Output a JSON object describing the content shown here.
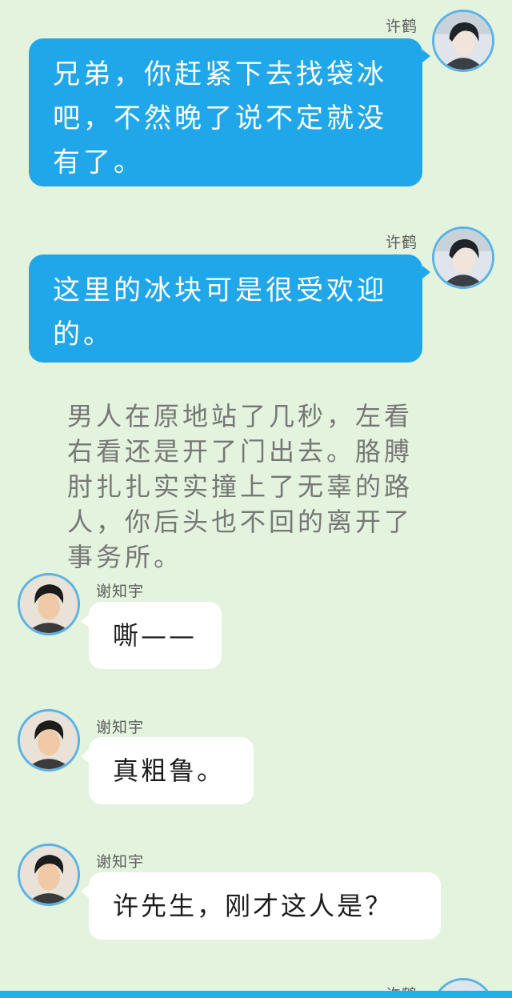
{
  "messages": [
    {
      "sender": "许鹤",
      "text": "兄弟，你赶紧下去找袋冰吧，不然晚了说不定就没有了。",
      "side": "right"
    },
    {
      "sender": "许鹤",
      "text": "这里的冰块可是很受欢迎的。",
      "side": "right"
    },
    {
      "sender": "谢知宇",
      "text": "嘶——",
      "side": "left"
    },
    {
      "sender": "谢知宇",
      "text": "真粗鲁。",
      "side": "left"
    },
    {
      "sender": "谢知宇",
      "text": "许先生，刚才这人是？",
      "side": "left"
    },
    {
      "sender": "许鹤",
      "side": "right"
    }
  ],
  "narration": "男人在原地站了几秒，左看右看还是开了门出去。胳膊肘扎扎实实撞上了无辜的路人，你后头也不回的离开了事务所。",
  "colors": {
    "background": "#e3f3dd",
    "right_bubble": "#20a7ea",
    "left_bubble": "#ffffff",
    "avatar_ring": "#5ab2e6",
    "bottom_bar": "#1fb2e8"
  }
}
